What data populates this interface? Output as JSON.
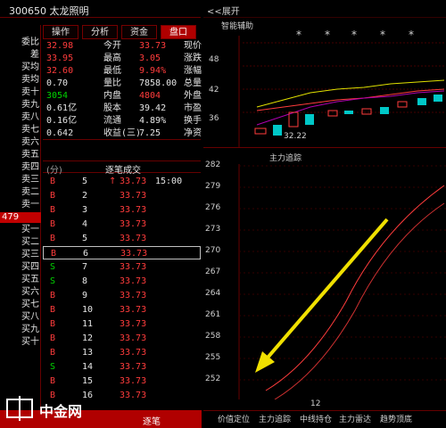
{
  "header": {
    "title": "300650 太龙照明",
    "expand_label": "<<展开"
  },
  "tabs": [
    "盘口",
    "资金",
    "分析",
    "操作"
  ],
  "quote": {
    "left_col": [
      {
        "label": "现价",
        "value": "33.73",
        "cls": "red"
      },
      {
        "label": "涨跌",
        "value": "3.05",
        "cls": "red"
      },
      {
        "label": "涨幅",
        "value": "9.94%",
        "cls": "red"
      },
      {
        "label": "总量",
        "value": "7858.00",
        "cls": "white"
      },
      {
        "label": "外盘",
        "value": "4804",
        "cls": "red"
      },
      {
        "label": "市盈",
        "value": "39.42",
        "cls": "white"
      },
      {
        "label": "换手",
        "value": "4.89%",
        "cls": "white"
      },
      {
        "label": "净资",
        "value": "7.25",
        "cls": "white"
      }
    ],
    "right_col": [
      {
        "label": "今开",
        "value": "32.98",
        "cls": "red"
      },
      {
        "label": "最高",
        "value": "33.95",
        "cls": "red"
      },
      {
        "label": "最低",
        "value": "32.60",
        "cls": "red"
      },
      {
        "label": "量比",
        "value": "0.70",
        "cls": "white"
      },
      {
        "label": "内盘",
        "value": "3054",
        "cls": "green"
      },
      {
        "label": "股本",
        "value": "0.61亿",
        "cls": "white"
      },
      {
        "label": "流通",
        "value": "0.16亿",
        "cls": "white"
      },
      {
        "label": "收益(三)",
        "value": "0.642",
        "cls": "white"
      }
    ]
  },
  "orderbook": {
    "sell_labels": [
      "卖十",
      "卖九",
      "卖八",
      "卖七",
      "卖六",
      "卖五",
      "卖四",
      "卖三",
      "卖二",
      "卖一"
    ],
    "highlight": "479",
    "buy_labels": [
      "买一",
      "买二",
      "买三",
      "买四",
      "买五",
      "买六",
      "买七",
      "买八",
      "买九",
      "买十"
    ],
    "top_items": [
      "委比",
      "差",
      "买均",
      "卖均"
    ]
  },
  "trades": {
    "header_left": "(分)",
    "header_right": "逐笔成交",
    "first_time": "15:00",
    "rows": [
      {
        "price": "33.73",
        "vol": "5",
        "flag": "B",
        "arrow": "↑"
      },
      {
        "price": "33.73",
        "vol": "2",
        "flag": "B",
        "arrow": ""
      },
      {
        "price": "33.73",
        "vol": "3",
        "flag": "B",
        "arrow": ""
      },
      {
        "price": "33.73",
        "vol": "4",
        "flag": "B",
        "arrow": ""
      },
      {
        "price": "33.73",
        "vol": "5",
        "flag": "B",
        "arrow": ""
      },
      {
        "price": "33.73",
        "vol": "6",
        "flag": "B",
        "arrow": ""
      },
      {
        "price": "33.73",
        "vol": "7",
        "flag": "S",
        "arrow": ""
      },
      {
        "price": "33.73",
        "vol": "8",
        "flag": "S",
        "arrow": ""
      },
      {
        "price": "33.73",
        "vol": "9",
        "flag": "B",
        "arrow": ""
      },
      {
        "price": "33.73",
        "vol": "10",
        "flag": "B",
        "arrow": ""
      },
      {
        "price": "33.73",
        "vol": "11",
        "flag": "B",
        "arrow": ""
      },
      {
        "price": "33.73",
        "vol": "12",
        "flag": "B",
        "arrow": ""
      },
      {
        "price": "33.73",
        "vol": "13",
        "flag": "B",
        "arrow": ""
      },
      {
        "price": "33.73",
        "vol": "14",
        "flag": "S",
        "arrow": ""
      },
      {
        "price": "33.73",
        "vol": "15",
        "flag": "B",
        "arrow": ""
      },
      {
        "price": "33.73",
        "vol": "16",
        "flag": "B",
        "arrow": ""
      }
    ]
  },
  "chart_top": {
    "title": "智能辅助",
    "y_ticks": [
      "48",
      "42",
      "36"
    ],
    "annotation": "32.22",
    "stars": [
      "*",
      "*",
      "*",
      "*",
      "*"
    ]
  },
  "chart_bottom": {
    "title": "主力追踪",
    "y_ticks": [
      "282",
      "279",
      "276",
      "273",
      "270",
      "267",
      "264",
      "261",
      "258",
      "255",
      "252"
    ],
    "x_label": "12"
  },
  "bottom_tabs": [
    "价值定位",
    "主力追踪",
    "中线持仓",
    "主力雷达",
    "趋势顶底"
  ],
  "bottom_left_label": "逐笔",
  "watermark": "中金网"
}
